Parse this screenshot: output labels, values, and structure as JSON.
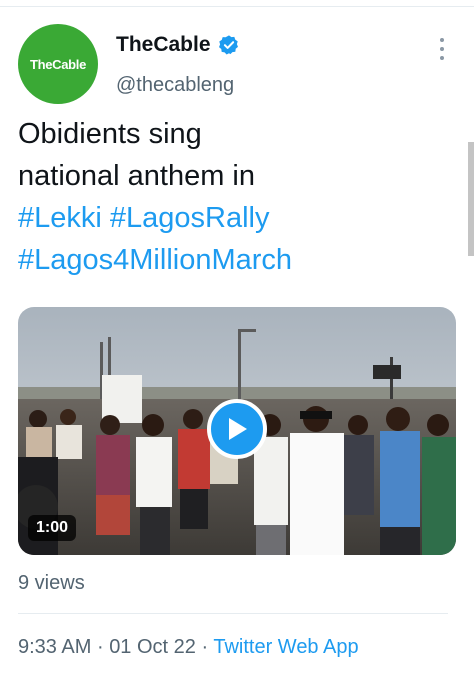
{
  "tweet": {
    "avatar_text": "TheCable",
    "display_name": "TheCable",
    "handle": "@thecableng",
    "text_lines": [
      "Obidients sing",
      "national anthem in"
    ],
    "hashtags_line1": [
      "#Lekki",
      "#LagosRally"
    ],
    "hashtags_line2": [
      "#Lagos4MillionMarch"
    ],
    "video_duration": "1:00",
    "views": "9 views",
    "time": "9:33 AM",
    "date": "01 Oct 22",
    "source": "Twitter Web App",
    "separator": "·"
  },
  "icons": {
    "verified": "verified-badge-icon",
    "more": "more-options-icon",
    "play": "play-icon"
  },
  "colors": {
    "accent": "#1d9bf0",
    "avatar_bg": "#3aa935",
    "text": "#0f1419",
    "secondary_text": "#536471"
  }
}
